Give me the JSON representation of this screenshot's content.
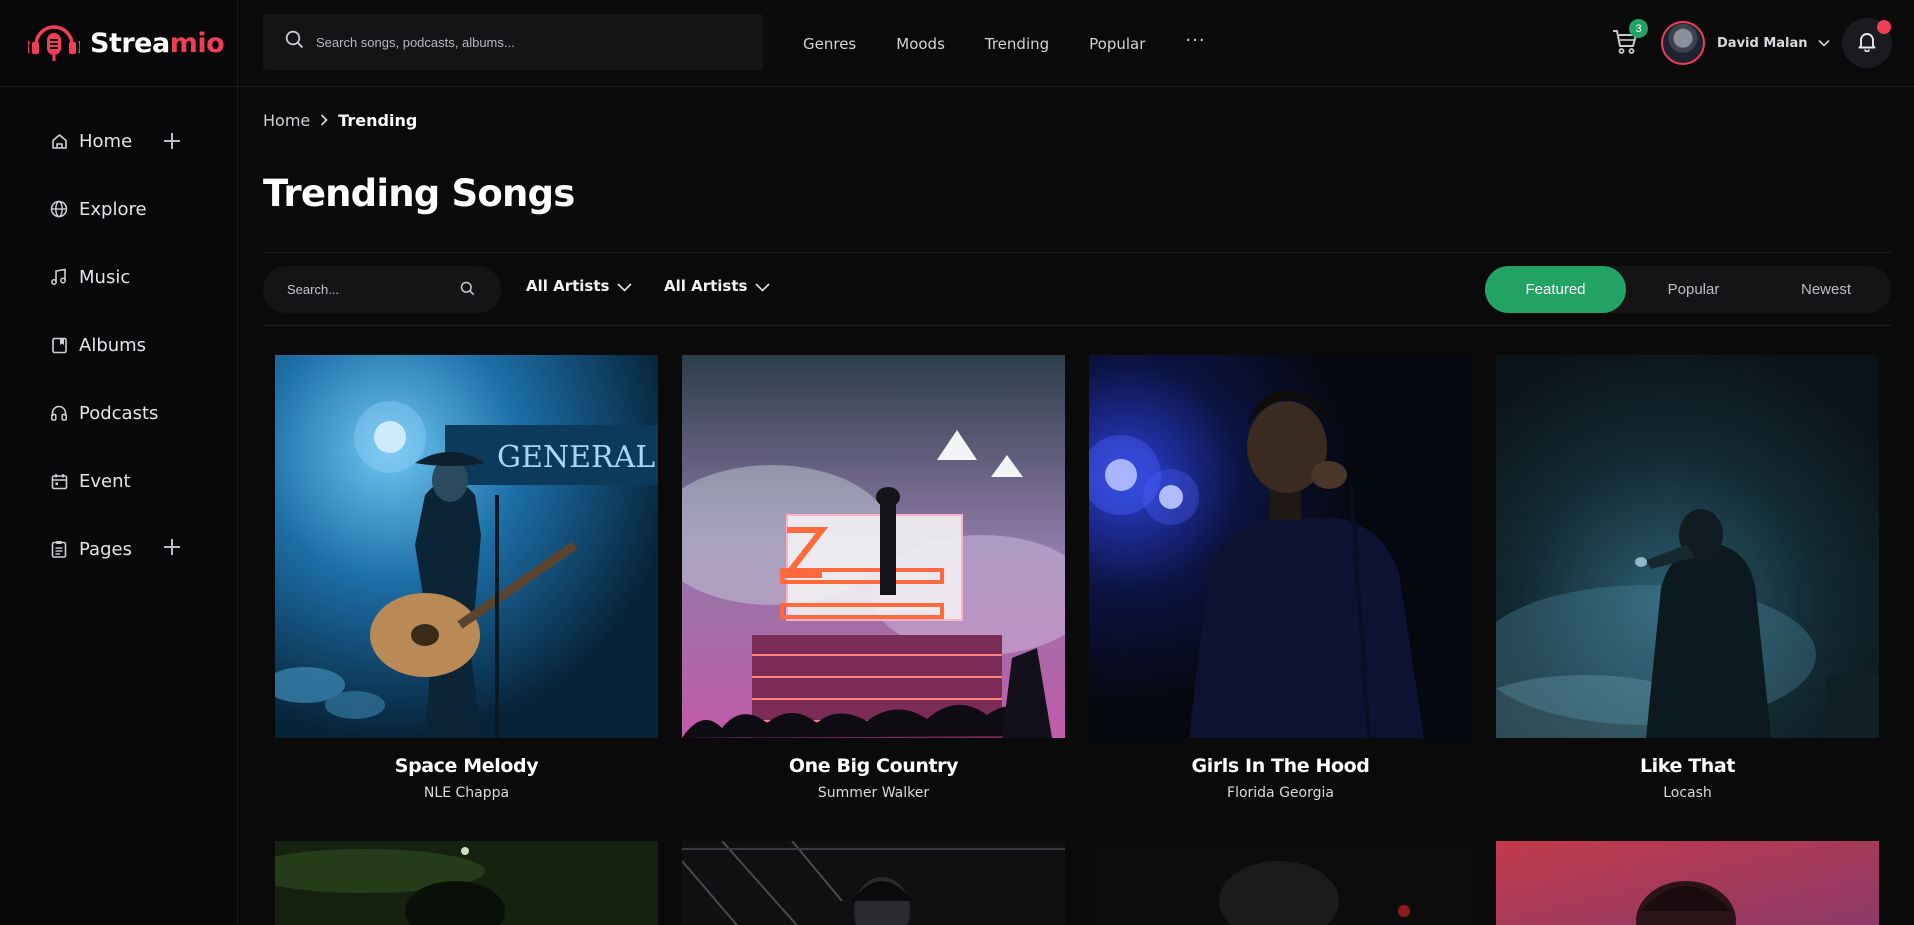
{
  "brand": {
    "name_part1": "Strea",
    "name_part2": "mio",
    "accent": "#ef3e55"
  },
  "search": {
    "placeholder": "Search songs, podcasts, albums..."
  },
  "top_nav": [
    {
      "label": "Genres"
    },
    {
      "label": "Moods"
    },
    {
      "label": "Trending"
    },
    {
      "label": "Popular"
    },
    {
      "label": "···"
    }
  ],
  "cart": {
    "count": "3",
    "icon": "cart-icon"
  },
  "user": {
    "name": "David Malan"
  },
  "notifications": {
    "icon": "bell-icon",
    "has_unread": true
  },
  "sidebar": {
    "items": [
      {
        "label": "Home",
        "icon": "home-icon",
        "expandable": true
      },
      {
        "label": "Explore",
        "icon": "globe-icon"
      },
      {
        "label": "Music",
        "icon": "music-note-icon"
      },
      {
        "label": "Albums",
        "icon": "album-icon"
      },
      {
        "label": "Podcasts",
        "icon": "headphones-icon"
      },
      {
        "label": "Event",
        "icon": "calendar-icon"
      },
      {
        "label": "Pages",
        "icon": "clipboard-icon",
        "expandable": true
      }
    ]
  },
  "breadcrumb": {
    "home": "Home",
    "current": "Trending"
  },
  "page": {
    "title": "Trending Songs"
  },
  "filters": {
    "search_placeholder": "Search...",
    "dropdown1": "All Artists",
    "dropdown2": "All Artists",
    "tabs": [
      {
        "label": "Featured",
        "active": true
      },
      {
        "label": "Popular",
        "active": false
      },
      {
        "label": "Newest",
        "active": false
      }
    ],
    "active_color": "#22a364"
  },
  "songs": [
    {
      "title": "Space Melody",
      "artist": "NLE Chappa"
    },
    {
      "title": "One Big Country",
      "artist": "Summer Walker"
    },
    {
      "title": "Girls In The Hood",
      "artist": "Florida Georgia"
    },
    {
      "title": "Like That",
      "artist": "Locash"
    }
  ]
}
